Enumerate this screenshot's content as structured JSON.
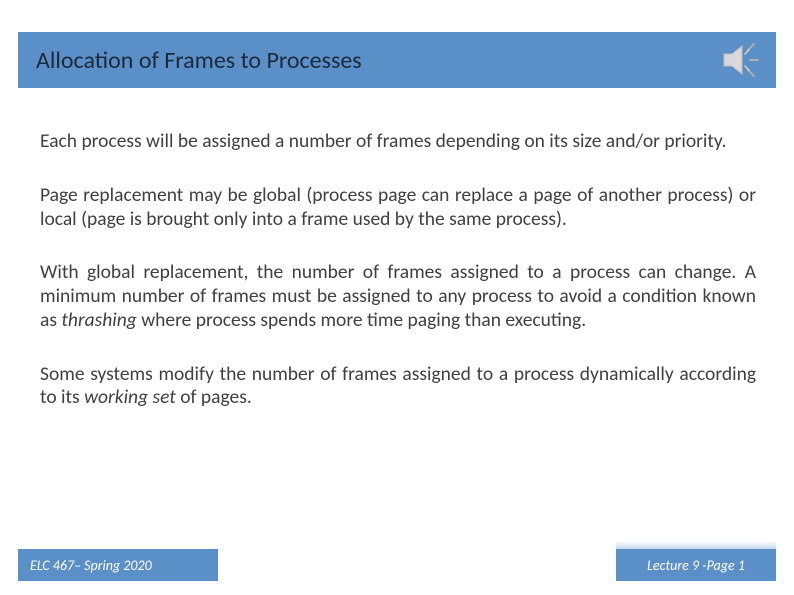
{
  "title": "Allocation of Frames to Processes",
  "paragraphs": {
    "p1": "Each process will be assigned a number of frames depending on its size and/or priority.",
    "p2": "Page replacement may be global (process page can replace a page of another process) or local (page is brought only into a frame used by the same process).",
    "p3a": "With global replacement, the number of frames assigned to a process can change.  A minimum number of frames must be assigned to any process to avoid a condition known as ",
    "p3_i": "thrashing",
    "p3b": " where process spends more time paging than executing.",
    "p4a": "Some systems modify the number of frames assigned to a process dynamically according to its ",
    "p4_i": "working set",
    "p4b": " of pages."
  },
  "footer": {
    "course": "ELC 467– Spring 2020",
    "pageinfo": "Lecture 9 -Page 1"
  },
  "icons": {
    "speaker": "speaker-icon"
  }
}
